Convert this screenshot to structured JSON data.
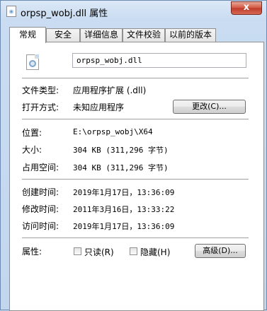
{
  "window": {
    "title": "orpsp_wobj.dll 属性",
    "close_label": "x"
  },
  "tabs": [
    {
      "label": "常规"
    },
    {
      "label": "安全"
    },
    {
      "label": "详细信息"
    },
    {
      "label": "文件校验"
    },
    {
      "label": "以前的版本"
    }
  ],
  "file": {
    "name": "orpsp_wobj.dll"
  },
  "props": {
    "type_label": "文件类型:",
    "type_value": "应用程序扩展 (.dll)",
    "open_label": "打开方式:",
    "open_value": "未知应用程序",
    "change_button": "更改(C)...",
    "location_label": "位置:",
    "location_value": "E:\\orpsp_wobj\\X64",
    "size_label": "大小:",
    "size_value": "304 KB (311,296 字节)",
    "disk_label": "占用空间:",
    "disk_value": "304 KB (311,296 字节)",
    "created_label": "创建时间:",
    "created_value": "2019年1月17日，13:36:09",
    "modified_label": "修改时间:",
    "modified_value": "2011年3月16日，13:33:22",
    "accessed_label": "访问时间:",
    "accessed_value": "2019年1月17日，13:36:09",
    "attr_label": "属性:",
    "readonly_label": "只读(R)",
    "hidden_label": "隐藏(H)",
    "advanced_button": "高级(D)..."
  }
}
